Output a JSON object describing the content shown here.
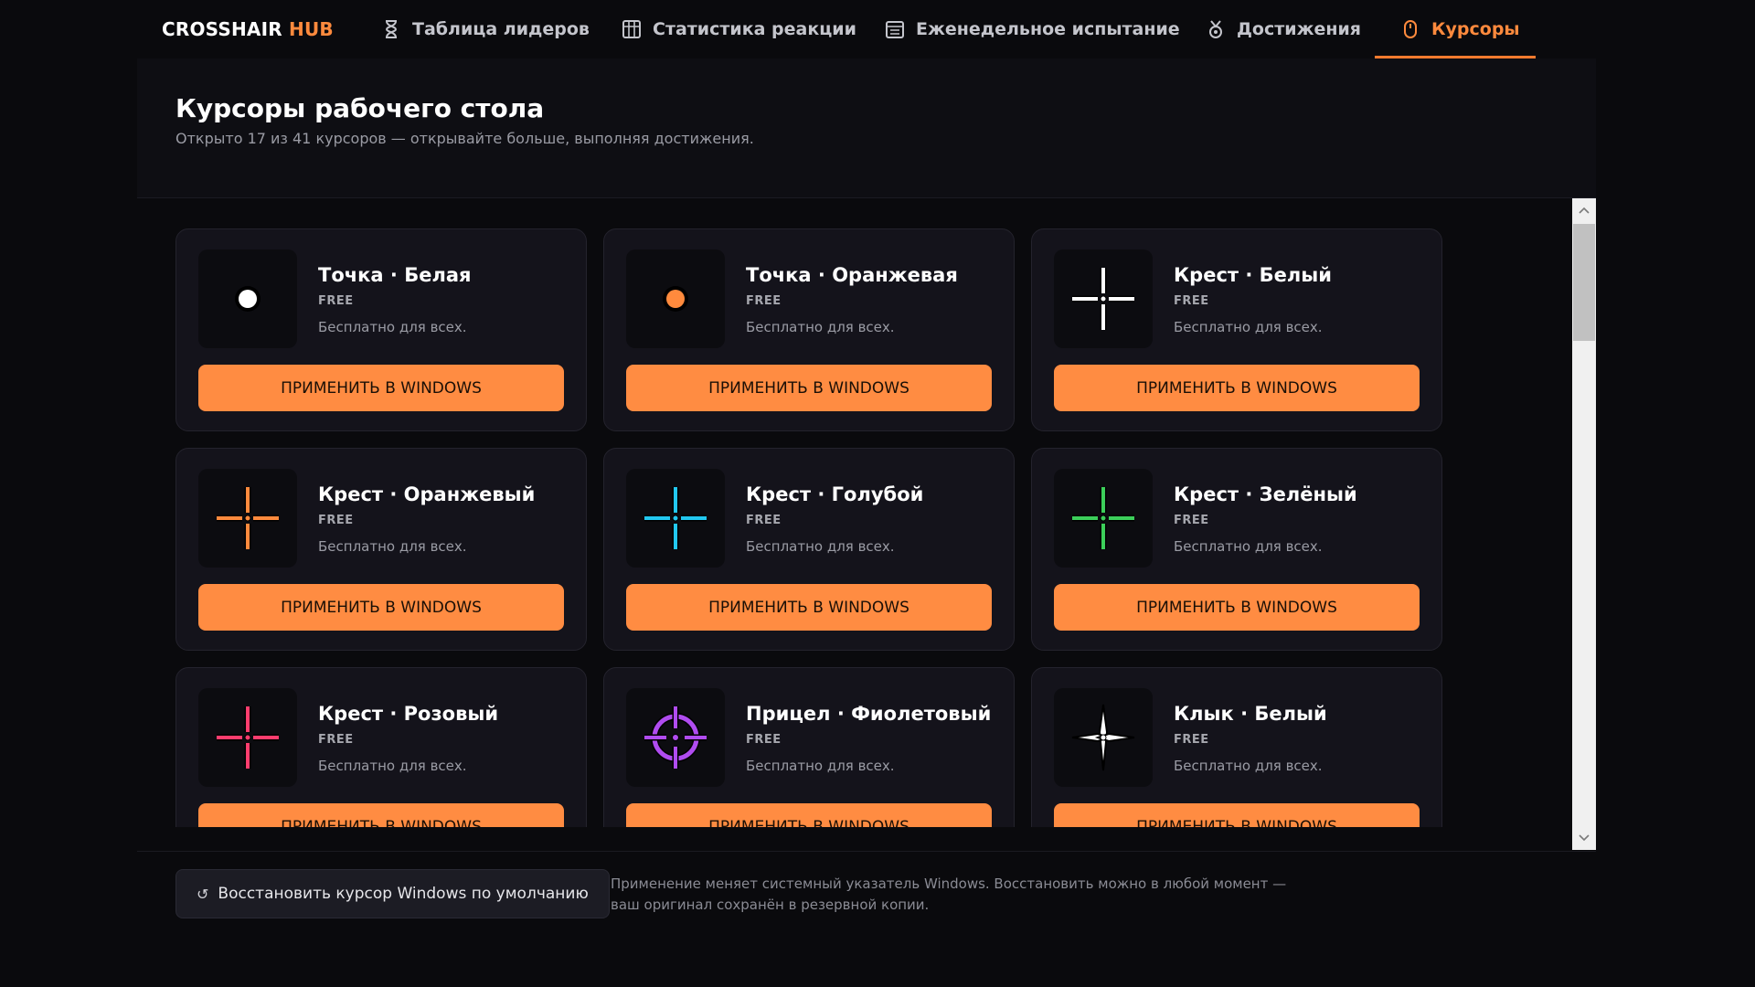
{
  "brand": {
    "part1": "CROSSHAIR ",
    "part2": "HUB"
  },
  "nav": {
    "tabs": [
      {
        "label": "Таблица лидеров",
        "icon": "hourglass-icon",
        "active": false
      },
      {
        "label": "Статистика реакции",
        "icon": "grid-chart-icon",
        "active": false
      },
      {
        "label": "Еженедельное испытание",
        "icon": "calendar-icon",
        "active": false
      },
      {
        "label": "Достижения",
        "icon": "medal-icon",
        "active": false
      },
      {
        "label": "Курсоры",
        "icon": "mouse-icon",
        "active": true
      }
    ]
  },
  "header": {
    "title": "Курсоры рабочего стола",
    "subtitle": "Открыто 17 из 41 курсоров — открывайте больше, выполняя достижения."
  },
  "cursors": [
    {
      "name": "Точка · Белая",
      "tier": "FREE",
      "desc": "Бесплатно для всех.",
      "button": "ПРИМЕНИТЬ В WINDOWS",
      "icon": "dot-white-icon",
      "color": "#ffffff"
    },
    {
      "name": "Точка · Оранжевая",
      "tier": "FREE",
      "desc": "Бесплатно для всех.",
      "button": "ПРИМЕНИТЬ В WINDOWS",
      "icon": "dot-orange-icon",
      "color": "#ff8a3d"
    },
    {
      "name": "Крест · Белый",
      "tier": "FREE",
      "desc": "Бесплатно для всех.",
      "button": "ПРИМЕНИТЬ В WINDOWS",
      "icon": "cross-white-icon",
      "color": "#ffffff"
    },
    {
      "name": "Крест · Оранжевый",
      "tier": "FREE",
      "desc": "Бесплатно для всех.",
      "button": "ПРИМЕНИТЬ В WINDOWS",
      "icon": "cross-orange-icon",
      "color": "#ff8a3d"
    },
    {
      "name": "Крест · Голубой",
      "tier": "FREE",
      "desc": "Бесплатно для всех.",
      "button": "ПРИМЕНИТЬ В WINDOWS",
      "icon": "cross-cyan-icon",
      "color": "#22c8f0"
    },
    {
      "name": "Крест · Зелёный",
      "tier": "FREE",
      "desc": "Бесплатно для всех.",
      "button": "ПРИМЕНИТЬ В WINDOWS",
      "icon": "cross-green-icon",
      "color": "#3ccf5a"
    },
    {
      "name": "Крест · Розовый",
      "tier": "FREE",
      "desc": "Бесплатно для всех.",
      "button": "ПРИМЕНИТЬ В WINDOWS",
      "icon": "cross-pink-icon",
      "color": "#ff3d6e"
    },
    {
      "name": "Прицел · Фиолетовый",
      "tier": "FREE",
      "desc": "Бесплатно для всех.",
      "button": "ПРИМЕНИТЬ В WINDOWS",
      "icon": "scope-purple-icon",
      "color": "#b04cf0"
    },
    {
      "name": "Клык · Белый",
      "tier": "FREE",
      "desc": "Бесплатно для всех.",
      "button": "ПРИМЕНИТЬ В WINDOWS",
      "icon": "fang-white-icon",
      "color": "#ffffff"
    }
  ],
  "footer": {
    "reset_label": "Восстановить курсор Windows по умолчанию",
    "reset_icon": "↺",
    "note": "Применение меняет системный указатель Windows. Восстановить можно в любой момент — ваш оригинал сохранён в резервной копии."
  },
  "colors": {
    "accent": "#ff8c42",
    "background": "#0a0a0d",
    "card": "#14131b"
  }
}
